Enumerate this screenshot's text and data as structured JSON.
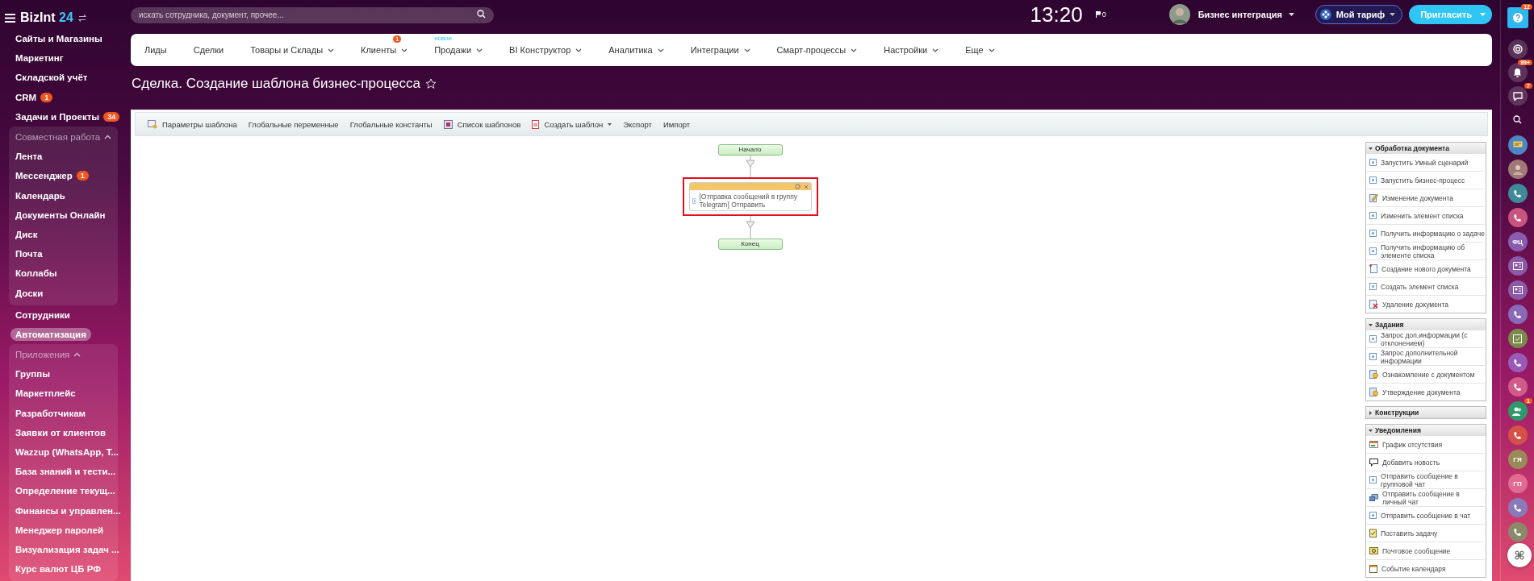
{
  "sidebar": {
    "logo": {
      "name": "BizInt",
      "suffix": "24"
    },
    "items": [
      {
        "kind": "item",
        "label": "Сайты и Магазины",
        "selected": false
      },
      {
        "kind": "item",
        "label": "Маркетинг",
        "selected": false
      },
      {
        "kind": "item",
        "label": "Складской учёт",
        "selected": false
      },
      {
        "kind": "item",
        "label": "CRM",
        "badge": "1",
        "selected": false
      },
      {
        "kind": "item",
        "label": "Задачи и Проекты",
        "badge": "34",
        "selected": false
      },
      {
        "kind": "group",
        "title": "Совместная работа",
        "expanded": true,
        "items": [
          {
            "label": "Лента",
            "selected": false
          },
          {
            "label": "Мессенджер",
            "badge": "1",
            "selected": false
          },
          {
            "label": "Календарь",
            "selected": false
          },
          {
            "label": "Документы Онлайн",
            "selected": false
          },
          {
            "label": "Диск",
            "selected": false
          },
          {
            "label": "Почта",
            "selected": false
          },
          {
            "label": "Коллабы",
            "selected": false
          },
          {
            "label": "Доски",
            "selected": false
          }
        ]
      },
      {
        "kind": "item",
        "label": "Сотрудники",
        "selected": false
      },
      {
        "kind": "item",
        "label": "Автоматизация",
        "selected": true
      },
      {
        "kind": "group",
        "title": "Приложения",
        "expanded": true,
        "items": [
          {
            "label": "Группы",
            "selected": false
          },
          {
            "label": "Маркетплейс",
            "selected": false
          },
          {
            "label": "Разработчикам",
            "selected": false
          },
          {
            "label": "Заявки от клиентов",
            "selected": false
          },
          {
            "label": "Wazzup (WhatsApp, T...",
            "selected": false
          },
          {
            "label": "База знаний и тести...",
            "selected": false
          },
          {
            "label": "Определение текущ...",
            "selected": false
          },
          {
            "label": "Финансы и управлен...",
            "selected": false
          },
          {
            "label": "Менеджер паролей",
            "selected": false
          },
          {
            "label": "Визуализация задач ...",
            "selected": false
          },
          {
            "label": "Курс валют ЦБ РФ",
            "selected": false
          }
        ]
      }
    ]
  },
  "search": {
    "placeholder": "искать сотрудника, документ, прочее..."
  },
  "header": {
    "time": "13:20",
    "flag_count": "0",
    "user": "Бизнес интеграция",
    "tariff": "Мой тариф",
    "invite": "Пригласить"
  },
  "nav": [
    {
      "label": "Лиды",
      "dropdown": false
    },
    {
      "label": "Сделки",
      "dropdown": false
    },
    {
      "label": "Товары и Склады",
      "dropdown": true
    },
    {
      "label": "Клиенты",
      "dropdown": true,
      "badge": "1"
    },
    {
      "label": "Продажи",
      "dropdown": true,
      "tag": "новое"
    },
    {
      "label": "BI Конструктор",
      "dropdown": true
    },
    {
      "label": "Аналитика",
      "dropdown": true
    },
    {
      "label": "Интеграции",
      "dropdown": true
    },
    {
      "label": "Смарт-процессы",
      "dropdown": true
    },
    {
      "label": "Настройки",
      "dropdown": true
    },
    {
      "label": "Еще",
      "dropdown": true
    }
  ],
  "page_title": "Сделка. Создание шаблона бизнес-процесса",
  "toolbar": [
    {
      "label": "Параметры шаблона",
      "kind": "params",
      "dropdown": false
    },
    {
      "label": "Глобальные переменные",
      "dropdown": false
    },
    {
      "label": "Глобальные константы",
      "dropdown": false
    },
    {
      "label": "Список шаблонов",
      "kind": "list",
      "dropdown": false
    },
    {
      "label": "Создать шаблон",
      "kind": "new",
      "dropdown": true
    },
    {
      "label": "Экспорт",
      "dropdown": false
    },
    {
      "label": "Импорт",
      "dropdown": false
    }
  ],
  "diagram": {
    "start": "Начало",
    "activity": {
      "text": "[Отправка сообщений в группу Telegram] Отправить",
      "highlighted": true
    },
    "end": "Конец"
  },
  "palette": [
    {
      "title": "Обработка документа",
      "expanded": true,
      "items": [
        {
          "label": "Запустить Умный сценарий",
          "kind": "block"
        },
        {
          "label": "Запустить бизнес-процесс",
          "kind": "block"
        },
        {
          "label": "Изменение документа",
          "kind": "edit"
        },
        {
          "label": "Изменить элемент списка",
          "kind": "block"
        },
        {
          "label": "Получить информацию о задаче",
          "kind": "block"
        },
        {
          "label": "Получить информацию об элементе списка",
          "kind": "block"
        },
        {
          "label": "Создание нового документа",
          "kind": "newdoc"
        },
        {
          "label": "Создать элемент списка",
          "kind": "block"
        },
        {
          "label": "Удаление документа",
          "kind": "delete"
        }
      ]
    },
    {
      "title": "Задания",
      "expanded": true,
      "items": [
        {
          "label": "Запрос доп.информации (с отклонением)",
          "kind": "block"
        },
        {
          "label": "Запрос дополнительной информации",
          "kind": "block"
        },
        {
          "label": "Ознакомление с документом",
          "kind": "review"
        },
        {
          "label": "Утверждение документа",
          "kind": "review"
        }
      ]
    },
    {
      "title": "Конструкции",
      "expanded": false
    },
    {
      "title": "Уведомления",
      "expanded": true,
      "items": [
        {
          "label": "График отсутствия",
          "kind": "schedule"
        },
        {
          "label": "Добавить новость",
          "kind": "news"
        },
        {
          "label": "Отправить сообщение в групповой чат",
          "kind": "block"
        },
        {
          "label": "Отправить сообщение в личный чат",
          "kind": "private"
        },
        {
          "label": "Отправить сообщение в чат",
          "kind": "block"
        },
        {
          "label": "Поставить задачу",
          "kind": "task"
        },
        {
          "label": "Почтовое сообщение",
          "kind": "mail"
        },
        {
          "label": "Событие календаря",
          "kind": "event"
        }
      ]
    }
  ],
  "rail_top": [
    {
      "kind": "help",
      "badge": "12"
    },
    {
      "kind": "activity"
    },
    {
      "kind": "bell",
      "badge": "99+"
    },
    {
      "kind": "chat",
      "badge": "7"
    },
    {
      "kind": "search"
    }
  ],
  "contacts": [
    {
      "kind": "chat",
      "color": "#4e86c4"
    },
    {
      "kind": "person",
      "color": "#a07878"
    },
    {
      "kind": "phone",
      "color": "#3f8a98"
    },
    {
      "kind": "phone",
      "color": "#c9557e"
    },
    {
      "kind": "initials",
      "text": "ФЦ",
      "color": "#8a5cb0"
    },
    {
      "kind": "card",
      "color": "#8a5aa8"
    },
    {
      "kind": "card",
      "color": "#8a5aa8"
    },
    {
      "kind": "phone",
      "color": "#8a6ab8"
    },
    {
      "kind": "check",
      "color": "#7a8a4a"
    },
    {
      "kind": "phone",
      "color": "#9a5ab8"
    },
    {
      "kind": "phone",
      "color": "#d05a88"
    },
    {
      "kind": "group",
      "color": "#2e9a6a",
      "badge": "1"
    },
    {
      "kind": "phone",
      "color": "#d6504a"
    },
    {
      "kind": "initials",
      "text": "ГЯ",
      "color": "#9a8a5a"
    },
    {
      "kind": "initials",
      "text": "ГП",
      "color": "#e06a90"
    },
    {
      "kind": "phone",
      "color": "#8a7ab8"
    },
    {
      "kind": "phone",
      "color": "#8a8a6a"
    }
  ]
}
